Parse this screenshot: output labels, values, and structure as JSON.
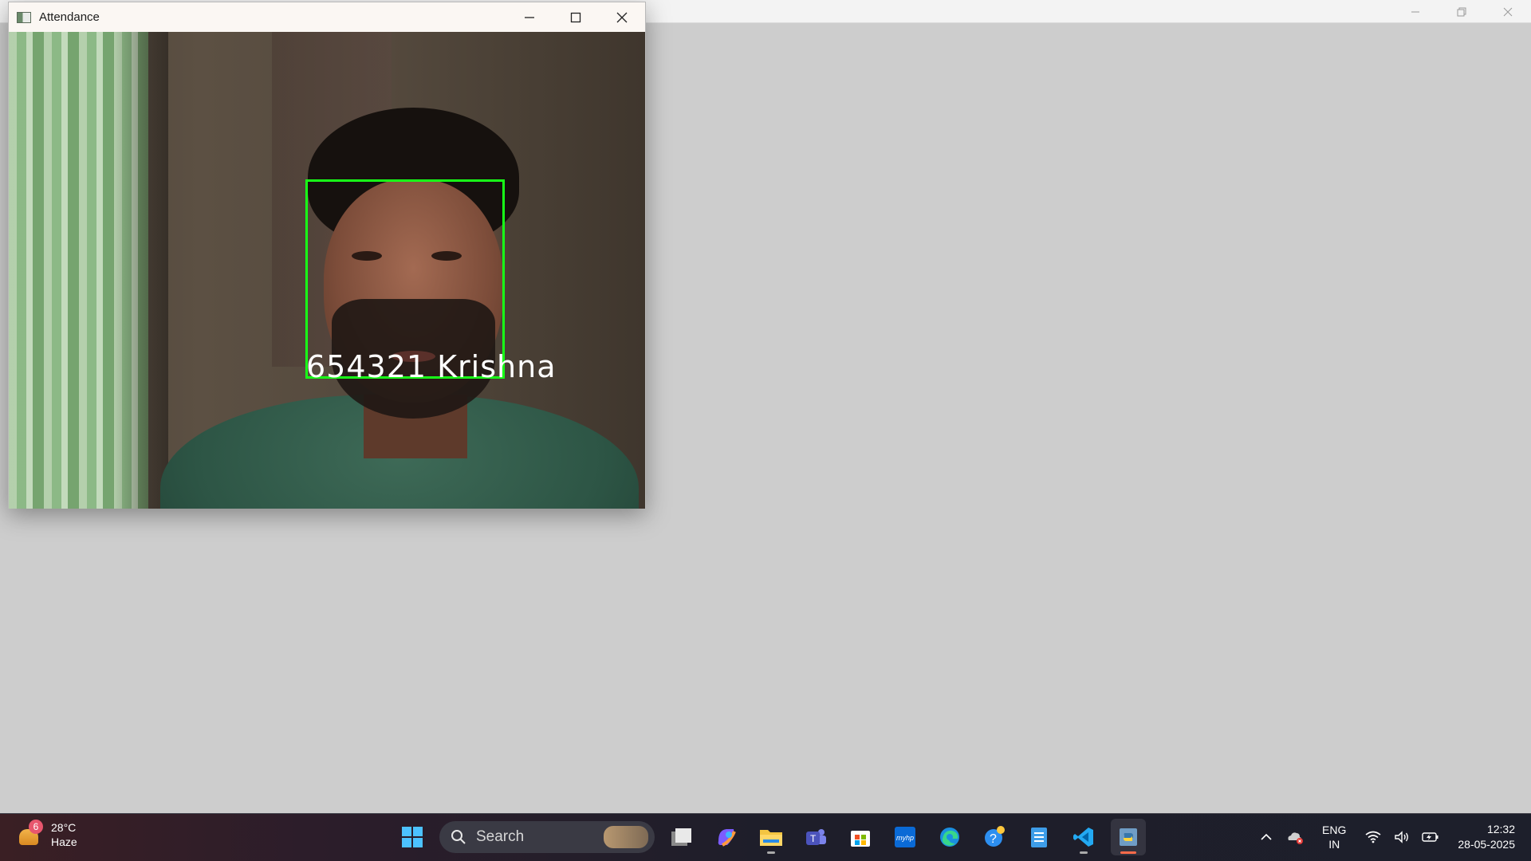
{
  "window": {
    "title": "Attendance",
    "recognition_label": "654321  Krishna"
  },
  "colors": {
    "face_box": "#18ff18",
    "label": "#ffffff"
  },
  "taskbar": {
    "weather": {
      "temperature": "28°C",
      "condition": "Haze",
      "badge": "6"
    },
    "search": {
      "label": "Search"
    },
    "apps": [
      "task-view",
      "copilot",
      "file-explorer",
      "teams",
      "microsoft-store",
      "myhp",
      "edge",
      "get-help",
      "notepad",
      "vscode",
      "python"
    ],
    "language": {
      "line1": "ENG",
      "line2": "IN"
    },
    "clock": {
      "time": "12:32",
      "date": "28-05-2025"
    }
  }
}
